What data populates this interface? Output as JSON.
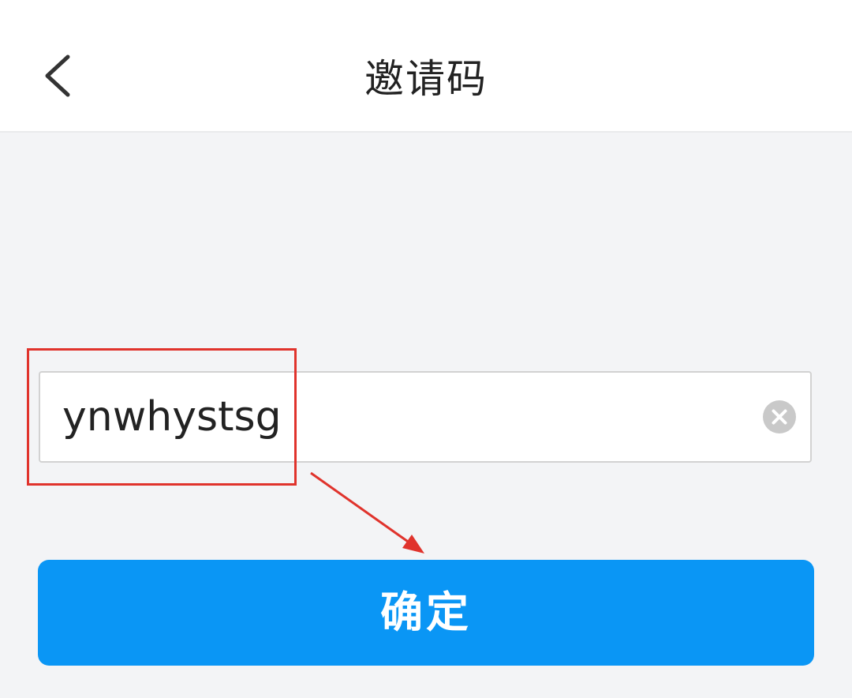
{
  "header": {
    "title": "邀请码",
    "back_icon": "chevron-left-icon"
  },
  "invite": {
    "value": "ynwhystsg",
    "clear_icon": "clear-circle-icon"
  },
  "confirm": {
    "label": "确定"
  },
  "annotation": {
    "highlight_color": "#e0332c",
    "arrow_color": "#e0332c"
  },
  "colors": {
    "primary": "#0a96f5",
    "background": "#f3f4f6",
    "header_bg": "#ffffff"
  }
}
